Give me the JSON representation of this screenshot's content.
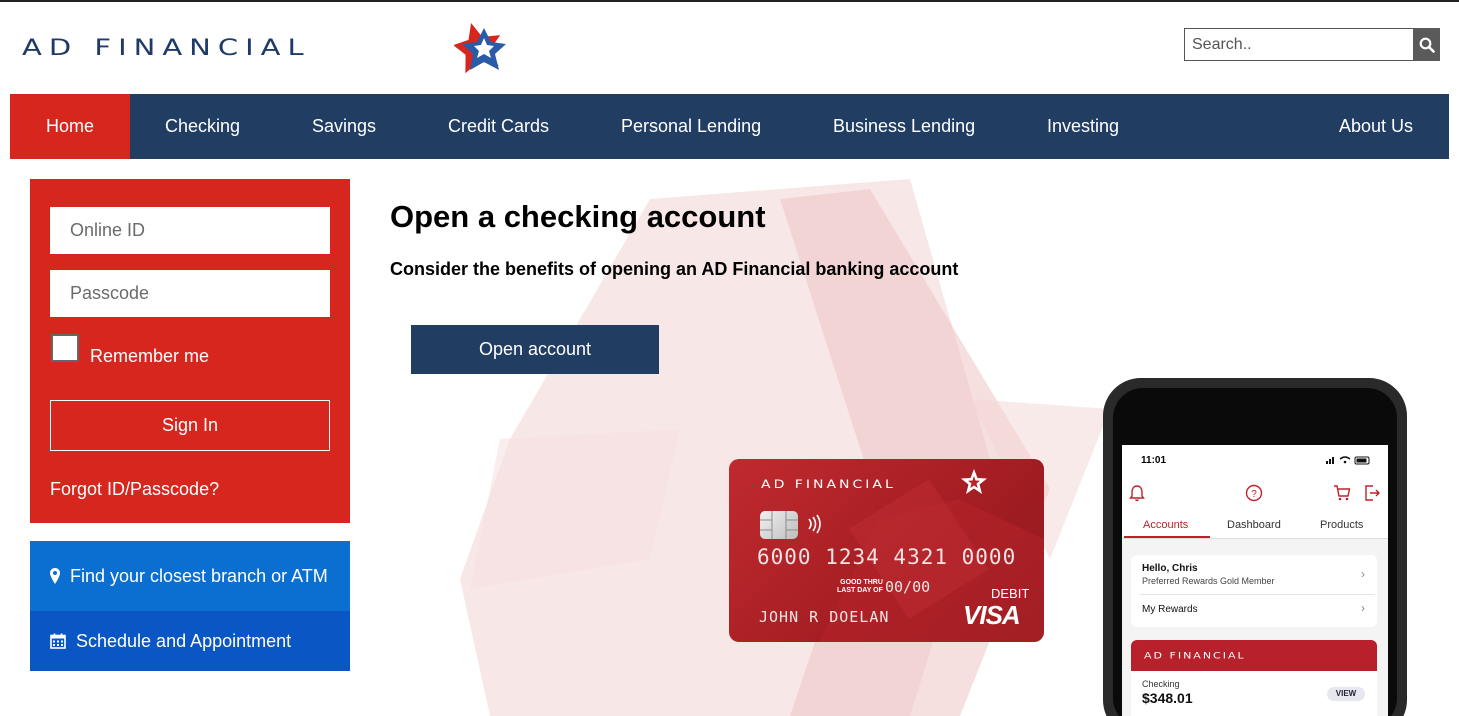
{
  "header": {
    "logo_text": "AD FINANCIAL",
    "search_placeholder": "Search.."
  },
  "nav": {
    "items": [
      {
        "label": "Home",
        "active": true
      },
      {
        "label": "Checking"
      },
      {
        "label": "Savings"
      },
      {
        "label": "Credit Cards"
      },
      {
        "label": "Personal Lending"
      },
      {
        "label": "Business Lending"
      },
      {
        "label": "Investing"
      },
      {
        "label": "About Us"
      }
    ]
  },
  "login": {
    "online_id_placeholder": "Online ID",
    "passcode_placeholder": "Passcode",
    "remember_label": "Remember me",
    "sign_in_label": "Sign In",
    "forgot_label": "Forgot ID/Passcode?"
  },
  "quick_links": {
    "branch_label": "Find your closest branch or ATM",
    "appointment_label": "Schedule and Appointment"
  },
  "hero": {
    "headline": "Open a checking account",
    "subheadline": "Consider the benefits of opening an AD Financial banking account",
    "cta_label": "Open account"
  },
  "debit_card": {
    "brand": "AD FINANCIAL",
    "number": "6000 1234 4321 0000",
    "good_thru_line1": "GOOD THRU",
    "good_thru_line2": "LAST DAY OF",
    "expiry": "00/00",
    "holder": "JOHN R DOELAN",
    "type": "DEBIT",
    "network": "VISA"
  },
  "phone_app": {
    "time": "11:01",
    "tabs": [
      "Accounts",
      "Dashboard",
      "Products"
    ],
    "greeting": "Hello, Chris",
    "membership": "Preferred Rewards Gold Member",
    "rewards_label": "My Rewards",
    "account_brand": "AD FINANCIAL",
    "account_label": "Checking",
    "account_balance": "$348.01",
    "view_label": "VIEW"
  },
  "colors": {
    "brand_red": "#d6261e",
    "brand_navy": "#213e62",
    "branch_blue": "#0a6fd0",
    "appointment_blue": "#0a56c4"
  }
}
